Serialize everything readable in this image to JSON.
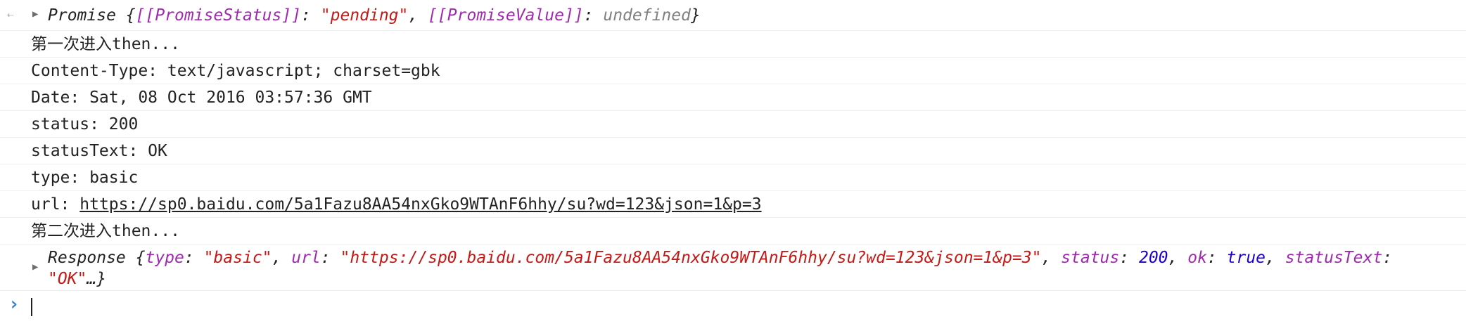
{
  "promise_line": {
    "expand_icon": "triangle-right-icon",
    "label": "Promise",
    "open_brace": " {",
    "status_key": "[[PromiseStatus]]",
    "sep1": ": ",
    "status_val": "\"pending\"",
    "comma": ", ",
    "value_key": "[[PromiseValue]]",
    "sep2": ": ",
    "value_val": "undefined",
    "close_brace": "}"
  },
  "log_lines": [
    "第一次进入then...",
    "Content-Type: text/javascript; charset=gbk",
    "Date: Sat, 08 Oct 2016 03:57:36 GMT",
    "status: 200",
    "statusText: OK",
    "type: basic"
  ],
  "url_line": {
    "prefix": "url: ",
    "link": "https://sp0.baidu.com/5a1Fazu8AA54nxGko9WTAnF6hhy/su?wd=123&json=1&p=3"
  },
  "second_then": "第二次进入then...",
  "response_line": {
    "label": "Response",
    "open": " {",
    "type_key": "type",
    "colon1": ": ",
    "type_val": "\"basic\"",
    "c1": ", ",
    "url_key": "url",
    "colon2": ": ",
    "url_val": "\"https://sp0.baidu.com/5a1Fazu8AA54nxGko9WTAnF6hhy/su?wd=123&json=1&p=3\"",
    "c2": ", ",
    "status_key": "status",
    "colon3": ": ",
    "status_val": "200",
    "c3": ", ",
    "ok_key": "ok",
    "colon4": ": ",
    "ok_val": "true",
    "c4": ", ",
    "statustext_key": "statusText",
    "colon5": ":",
    "statustext_val": "\"OK\"",
    "ellipsis": "…}"
  },
  "prompt": {
    "icon": "chevron-right-icon"
  }
}
